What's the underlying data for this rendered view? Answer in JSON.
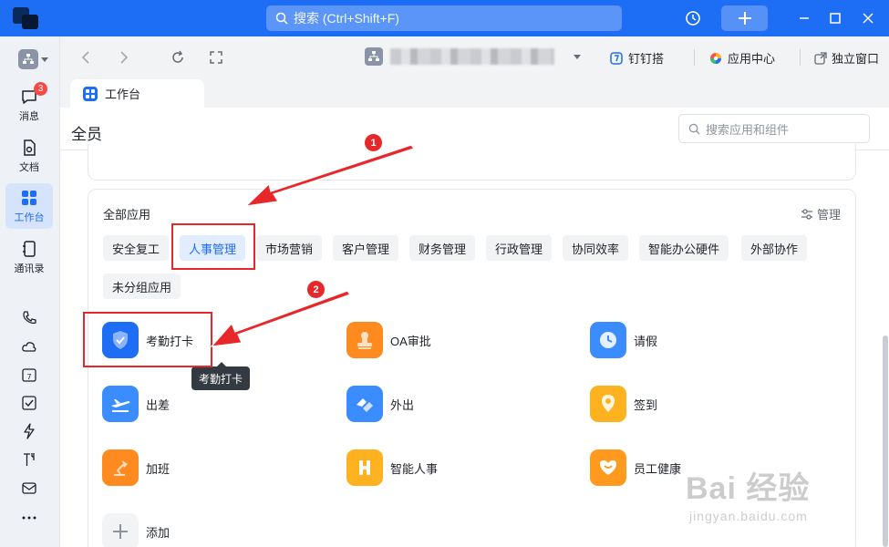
{
  "titlebar": {
    "search_placeholder": "搜索 (Ctrl+Shift+F)"
  },
  "sidebar": {
    "items": [
      {
        "label": "消息",
        "icon": "chat-icon",
        "badge": "3"
      },
      {
        "label": "文档",
        "icon": "doc-icon"
      },
      {
        "label": "工作台",
        "icon": "workbench-icon",
        "active": true
      },
      {
        "label": "通讯录",
        "icon": "contacts-icon"
      }
    ]
  },
  "navbar": {
    "links": [
      {
        "label": "钉钉搭"
      },
      {
        "label": "应用中心"
      },
      {
        "label": "独立窗口"
      }
    ]
  },
  "tab": {
    "label": "工作台"
  },
  "main": {
    "title": "全员",
    "search_placeholder": "搜索应用和组件",
    "all_apps_title": "全部应用",
    "manage_label": "管理",
    "chips": [
      "安全复工",
      "人事管理",
      "市场营销",
      "客户管理",
      "财务管理",
      "行政管理",
      "协同效率",
      "智能办公硬件",
      "外部协作",
      "未分组应用"
    ],
    "active_chip": "人事管理",
    "apps": [
      {
        "label": "考勤打卡",
        "color": "#1e6df5"
      },
      {
        "label": "OA审批",
        "color": "#ff8a1f"
      },
      {
        "label": "请假",
        "color": "#3b8cff"
      },
      {
        "label": "出差",
        "color": "#3b8cff"
      },
      {
        "label": "外出",
        "color": "#3b8cff"
      },
      {
        "label": "签到",
        "color": "#ffb21f"
      },
      {
        "label": "加班",
        "color": "#ff8a1f"
      },
      {
        "label": "智能人事",
        "color": "#ffb21f"
      },
      {
        "label": "员工健康",
        "color": "#ff9a1f"
      },
      {
        "label": "添加",
        "color": "#f2f3f5"
      }
    ],
    "tooltip": "考勤打卡"
  },
  "annotations": {
    "step1": "1",
    "step2": "2",
    "color": "#e8272b"
  },
  "watermark": {
    "main": "Bai  经验",
    "sub": "jingyan.baidu.com"
  }
}
